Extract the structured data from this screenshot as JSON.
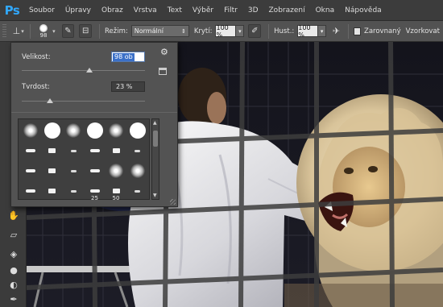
{
  "app": {
    "logo_text": "Ps"
  },
  "menu": {
    "items": [
      "Soubor",
      "Úpravy",
      "Obraz",
      "Vrstva",
      "Text",
      "Výběr",
      "Filtr",
      "3D",
      "Zobrazení",
      "Okna",
      "Nápověda"
    ]
  },
  "options_bar": {
    "brush_size": "98",
    "mode_label": "Režim:",
    "mode_value": "Normální",
    "opacity_label": "Krytí:",
    "opacity_value": "100 %",
    "flow_label": "Hust.:",
    "flow_value": "100 %",
    "aligned_label": "Zarovnaný",
    "sample_label": "Vzorkovat"
  },
  "brush_panel": {
    "size_label": "Velikost:",
    "size_value": "98 ob",
    "size_slider_fraction": 0.55,
    "hardness_label": "Tvrdost:",
    "hardness_value": "23 %",
    "hardness_slider_fraction": 0.23,
    "presets": [
      {
        "kind": "soft"
      },
      {
        "kind": "hard"
      },
      {
        "kind": "soft"
      },
      {
        "kind": "hard"
      },
      {
        "kind": "soft"
      },
      {
        "kind": "hard"
      },
      {
        "kind": "stroke"
      },
      {
        "kind": "stroke"
      },
      {
        "kind": "stroke"
      },
      {
        "kind": "stroke"
      },
      {
        "kind": "stroke"
      },
      {
        "kind": "stroke"
      },
      {
        "kind": "stroke"
      },
      {
        "kind": "stroke"
      },
      {
        "kind": "stroke"
      },
      {
        "kind": "stroke"
      },
      {
        "kind": "soft"
      },
      {
        "kind": "soft"
      },
      {
        "kind": "stroke"
      },
      {
        "kind": "stroke"
      },
      {
        "kind": "stroke"
      },
      {
        "kind": "stroke",
        "label": "25"
      },
      {
        "kind": "stroke",
        "label": "50"
      },
      {
        "kind": "stroke"
      }
    ]
  },
  "colors": {
    "ps_blue": "#31a8ff",
    "panel_bg": "#535353",
    "menubar_bg": "#3c3c3c",
    "selection_highlight": "#3b70c8"
  }
}
